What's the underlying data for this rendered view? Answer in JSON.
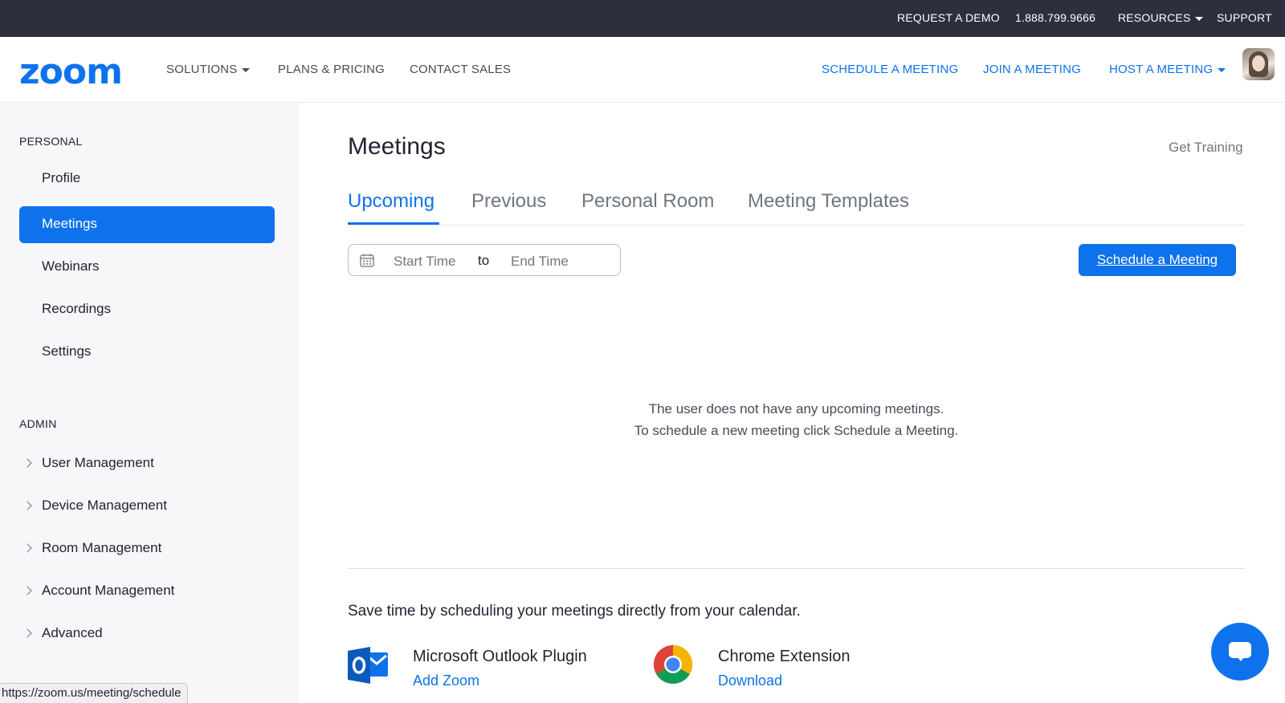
{
  "topbar": {
    "request_demo": "REQUEST A DEMO",
    "phone": "1.888.799.9666",
    "resources": "RESOURCES",
    "support": "SUPPORT"
  },
  "nav": {
    "logo": "zoom",
    "solutions": "SOLUTIONS",
    "plans": "PLANS & PRICING",
    "contact": "CONTACT SALES",
    "schedule": "SCHEDULE A MEETING",
    "join": "JOIN A MEETING",
    "host": "HOST A MEETING"
  },
  "sidebar": {
    "personal_heading": "PERSONAL",
    "personal_items": [
      "Profile",
      "Meetings",
      "Webinars",
      "Recordings",
      "Settings"
    ],
    "admin_heading": "ADMIN",
    "admin_items": [
      "User Management",
      "Device Management",
      "Room Management",
      "Account Management",
      "Advanced"
    ]
  },
  "main": {
    "title": "Meetings",
    "get_training": "Get Training",
    "tabs": [
      "Upcoming",
      "Previous",
      "Personal Room",
      "Meeting Templates"
    ],
    "date_start": "Start Time",
    "date_to": "to",
    "date_end": "End Time",
    "schedule_button": "Schedule a Meeting",
    "empty_line1": "The user does not have any upcoming meetings.",
    "empty_line2": "To schedule a new meeting click Schedule a Meeting.",
    "calendar_prompt": "Save time by scheduling your meetings directly from your calendar.",
    "outlook_title": "Microsoft Outlook Plugin",
    "outlook_link": "Add Zoom",
    "chrome_title": "Chrome Extension",
    "chrome_link": "Download"
  },
  "status_bar": {
    "url": "https://zoom.us/meeting/schedule"
  },
  "colors": {
    "brand_blue": "#0e72ed",
    "topbar_bg": "#2d2e3e",
    "sidebar_bg": "#f7f7fa"
  }
}
